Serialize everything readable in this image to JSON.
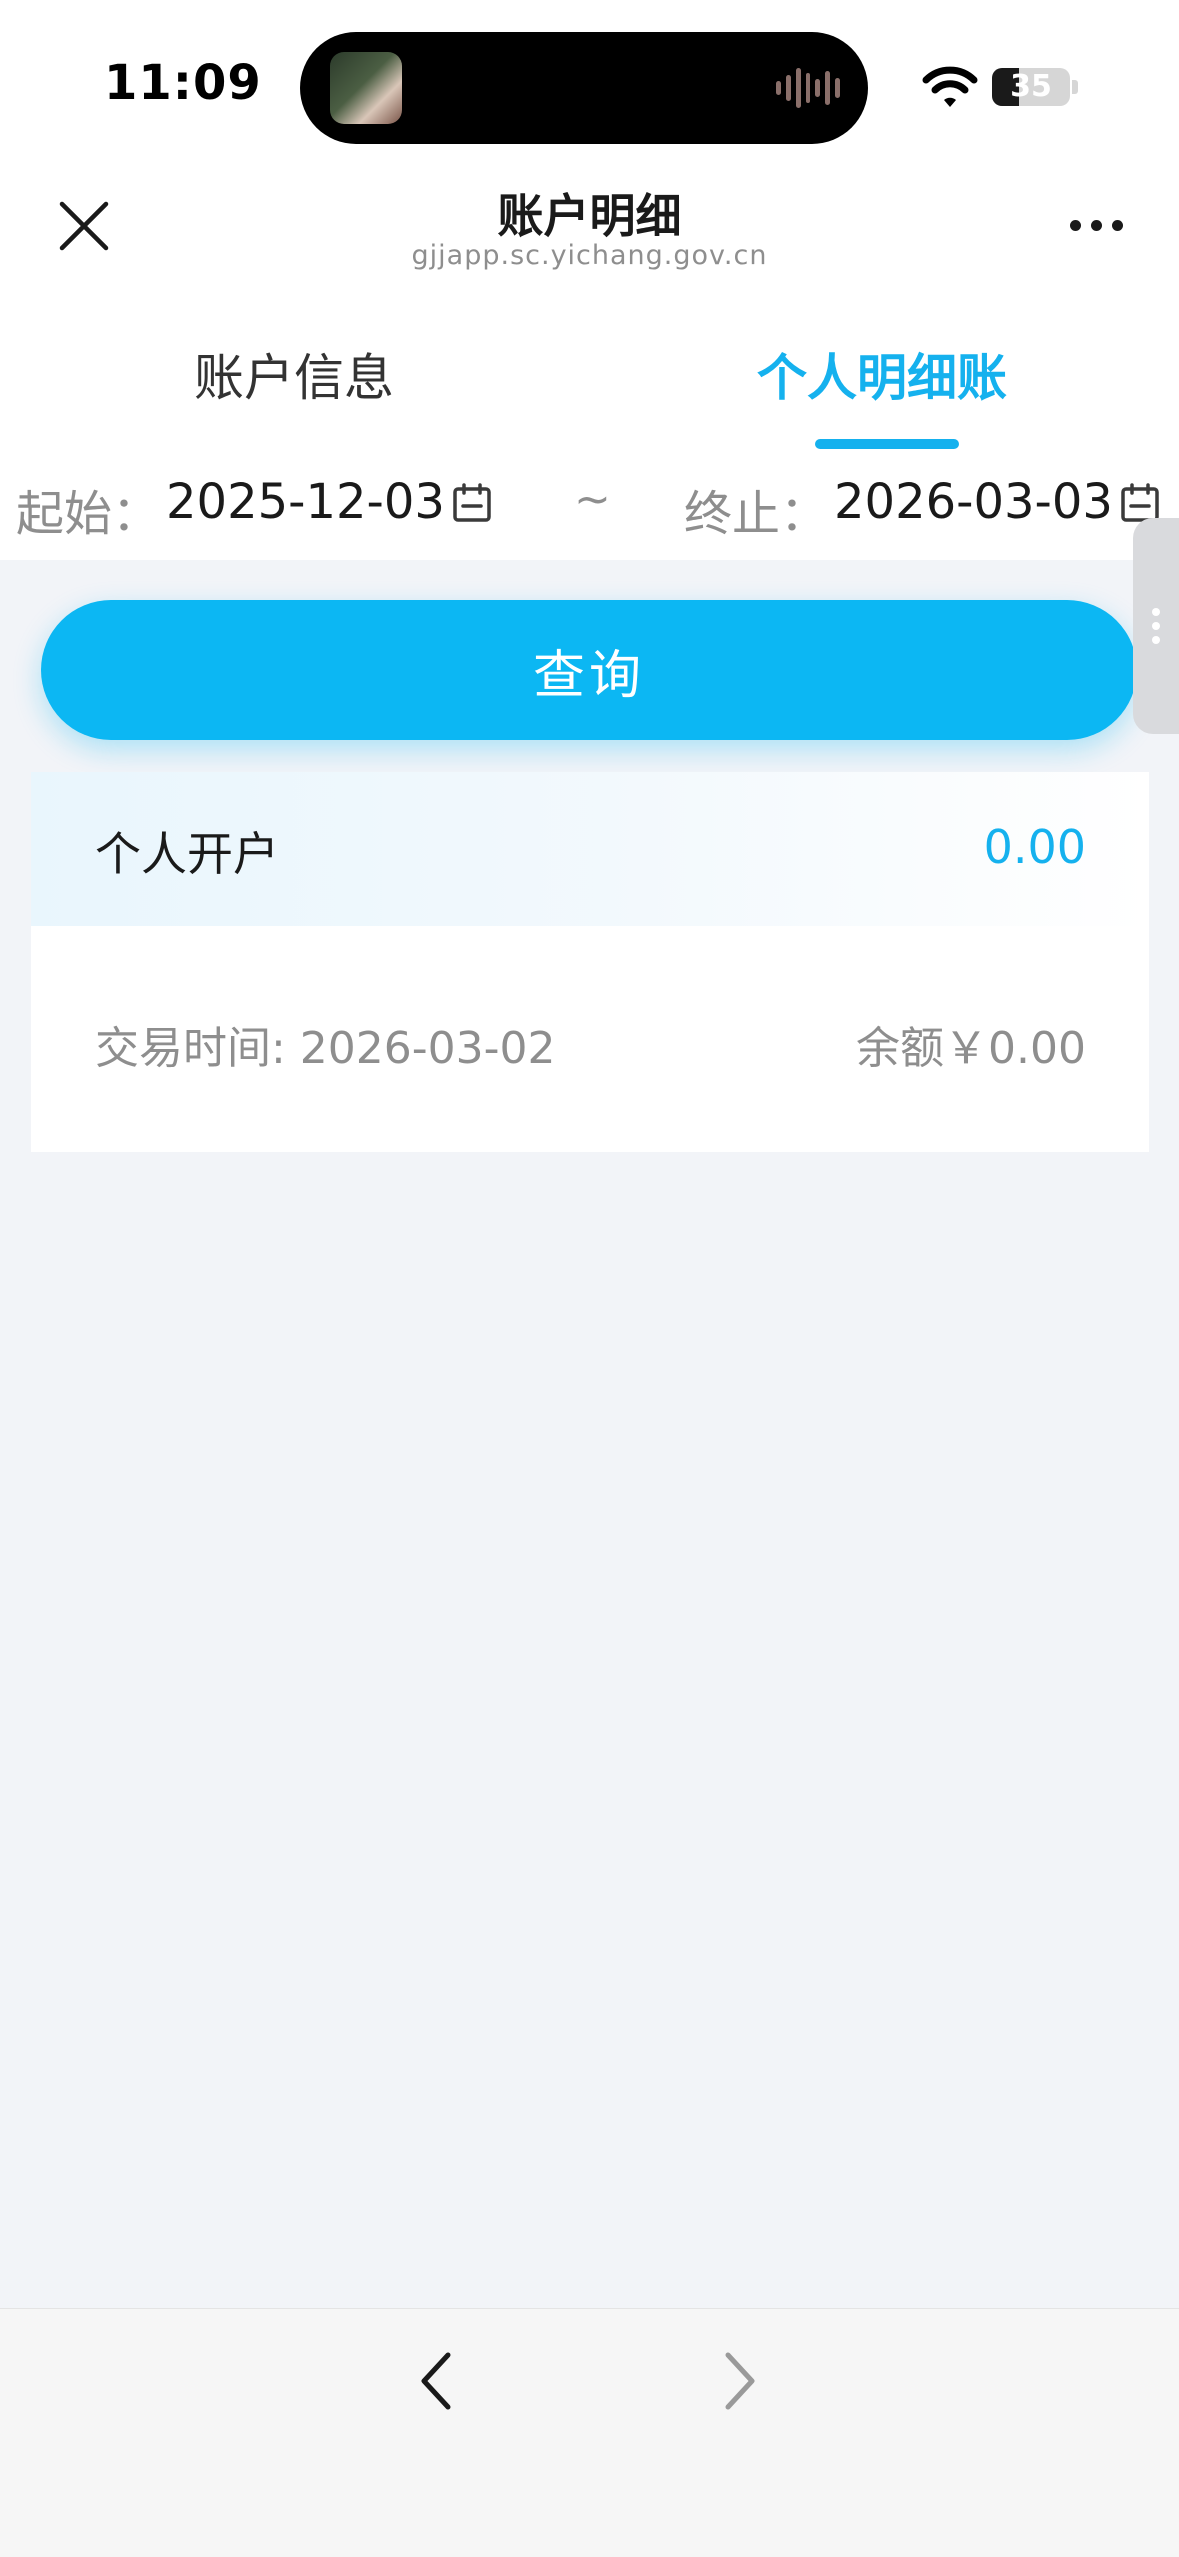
{
  "status_bar": {
    "time": "11:09",
    "battery_level": "35",
    "battery_fraction": 0.35
  },
  "nav": {
    "title": "账户明细",
    "subtitle": "gjjapp.sc.yichang.gov.cn"
  },
  "tabs": [
    {
      "label": "账户信息",
      "active": false
    },
    {
      "label": "个人明细账",
      "active": true
    }
  ],
  "filter": {
    "start_label": "起始：",
    "start_date": "2025-12-03",
    "separator": "~",
    "end_label": "终止：",
    "end_date": "2026-03-03"
  },
  "query_button_label": "查询",
  "records": [
    {
      "type": "个人开户",
      "amount": "0.00",
      "time_text": "交易时间: 2026-03-02",
      "balance_text": "余额￥0.00"
    }
  ],
  "colors": {
    "accent": "#15b1ee",
    "button": "#0cb7f3",
    "background": "#f2f4f8"
  },
  "icons": [
    "close-icon",
    "more-icon",
    "calendar-icon",
    "back-icon",
    "forward-icon",
    "wifi-icon",
    "battery-icon"
  ]
}
